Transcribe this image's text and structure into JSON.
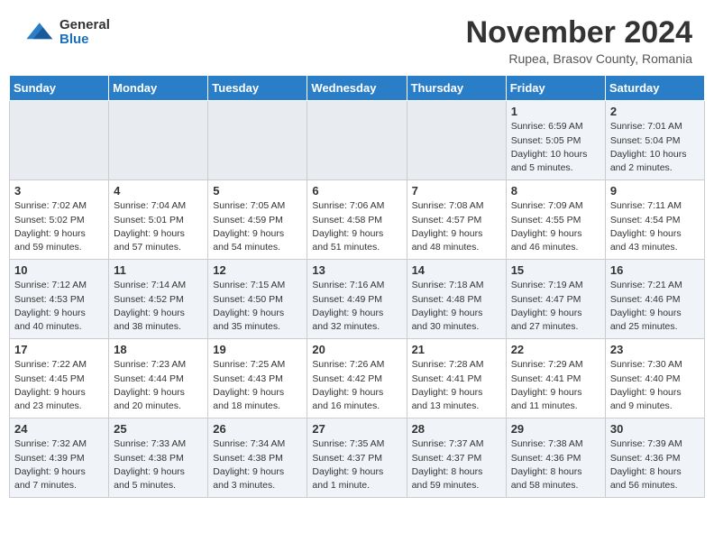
{
  "logo": {
    "general": "General",
    "blue": "Blue"
  },
  "header": {
    "month": "November 2024",
    "location": "Rupea, Brasov County, Romania"
  },
  "weekdays": [
    "Sunday",
    "Monday",
    "Tuesday",
    "Wednesday",
    "Thursday",
    "Friday",
    "Saturday"
  ],
  "weeks": [
    [
      {
        "day": "",
        "empty": true
      },
      {
        "day": "",
        "empty": true
      },
      {
        "day": "",
        "empty": true
      },
      {
        "day": "",
        "empty": true
      },
      {
        "day": "",
        "empty": true
      },
      {
        "day": "1",
        "sunrise": "6:59 AM",
        "sunset": "5:05 PM",
        "daylight": "10 hours and 5 minutes."
      },
      {
        "day": "2",
        "sunrise": "7:01 AM",
        "sunset": "5:04 PM",
        "daylight": "10 hours and 2 minutes."
      }
    ],
    [
      {
        "day": "3",
        "sunrise": "7:02 AM",
        "sunset": "5:02 PM",
        "daylight": "9 hours and 59 minutes."
      },
      {
        "day": "4",
        "sunrise": "7:04 AM",
        "sunset": "5:01 PM",
        "daylight": "9 hours and 57 minutes."
      },
      {
        "day": "5",
        "sunrise": "7:05 AM",
        "sunset": "4:59 PM",
        "daylight": "9 hours and 54 minutes."
      },
      {
        "day": "6",
        "sunrise": "7:06 AM",
        "sunset": "4:58 PM",
        "daylight": "9 hours and 51 minutes."
      },
      {
        "day": "7",
        "sunrise": "7:08 AM",
        "sunset": "4:57 PM",
        "daylight": "9 hours and 48 minutes."
      },
      {
        "day": "8",
        "sunrise": "7:09 AM",
        "sunset": "4:55 PM",
        "daylight": "9 hours and 46 minutes."
      },
      {
        "day": "9",
        "sunrise": "7:11 AM",
        "sunset": "4:54 PM",
        "daylight": "9 hours and 43 minutes."
      }
    ],
    [
      {
        "day": "10",
        "sunrise": "7:12 AM",
        "sunset": "4:53 PM",
        "daylight": "9 hours and 40 minutes."
      },
      {
        "day": "11",
        "sunrise": "7:14 AM",
        "sunset": "4:52 PM",
        "daylight": "9 hours and 38 minutes."
      },
      {
        "day": "12",
        "sunrise": "7:15 AM",
        "sunset": "4:50 PM",
        "daylight": "9 hours and 35 minutes."
      },
      {
        "day": "13",
        "sunrise": "7:16 AM",
        "sunset": "4:49 PM",
        "daylight": "9 hours and 32 minutes."
      },
      {
        "day": "14",
        "sunrise": "7:18 AM",
        "sunset": "4:48 PM",
        "daylight": "9 hours and 30 minutes."
      },
      {
        "day": "15",
        "sunrise": "7:19 AM",
        "sunset": "4:47 PM",
        "daylight": "9 hours and 27 minutes."
      },
      {
        "day": "16",
        "sunrise": "7:21 AM",
        "sunset": "4:46 PM",
        "daylight": "9 hours and 25 minutes."
      }
    ],
    [
      {
        "day": "17",
        "sunrise": "7:22 AM",
        "sunset": "4:45 PM",
        "daylight": "9 hours and 23 minutes."
      },
      {
        "day": "18",
        "sunrise": "7:23 AM",
        "sunset": "4:44 PM",
        "daylight": "9 hours and 20 minutes."
      },
      {
        "day": "19",
        "sunrise": "7:25 AM",
        "sunset": "4:43 PM",
        "daylight": "9 hours and 18 minutes."
      },
      {
        "day": "20",
        "sunrise": "7:26 AM",
        "sunset": "4:42 PM",
        "daylight": "9 hours and 16 minutes."
      },
      {
        "day": "21",
        "sunrise": "7:28 AM",
        "sunset": "4:41 PM",
        "daylight": "9 hours and 13 minutes."
      },
      {
        "day": "22",
        "sunrise": "7:29 AM",
        "sunset": "4:41 PM",
        "daylight": "9 hours and 11 minutes."
      },
      {
        "day": "23",
        "sunrise": "7:30 AM",
        "sunset": "4:40 PM",
        "daylight": "9 hours and 9 minutes."
      }
    ],
    [
      {
        "day": "24",
        "sunrise": "7:32 AM",
        "sunset": "4:39 PM",
        "daylight": "9 hours and 7 minutes."
      },
      {
        "day": "25",
        "sunrise": "7:33 AM",
        "sunset": "4:38 PM",
        "daylight": "9 hours and 5 minutes."
      },
      {
        "day": "26",
        "sunrise": "7:34 AM",
        "sunset": "4:38 PM",
        "daylight": "9 hours and 3 minutes."
      },
      {
        "day": "27",
        "sunrise": "7:35 AM",
        "sunset": "4:37 PM",
        "daylight": "9 hours and 1 minute."
      },
      {
        "day": "28",
        "sunrise": "7:37 AM",
        "sunset": "4:37 PM",
        "daylight": "8 hours and 59 minutes."
      },
      {
        "day": "29",
        "sunrise": "7:38 AM",
        "sunset": "4:36 PM",
        "daylight": "8 hours and 58 minutes."
      },
      {
        "day": "30",
        "sunrise": "7:39 AM",
        "sunset": "4:36 PM",
        "daylight": "8 hours and 56 minutes."
      }
    ]
  ]
}
